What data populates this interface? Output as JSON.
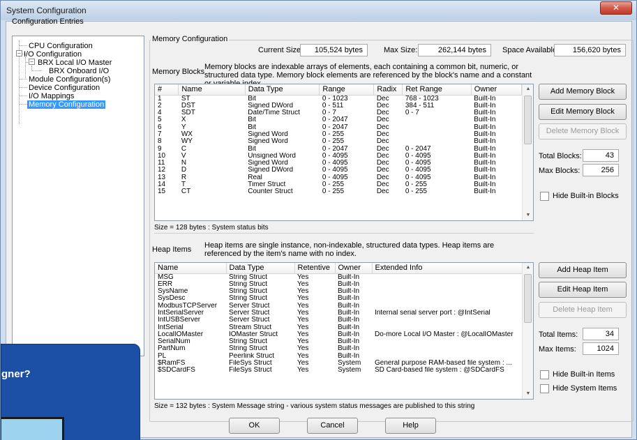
{
  "window": {
    "title": "System Configuration",
    "close_glyph": "✕"
  },
  "tree": {
    "heading": "Configuration Entries",
    "items": [
      {
        "label": "CPU Configuration"
      },
      {
        "label": "I/O Configuration",
        "expander": "−"
      },
      {
        "label": "BRX Local I/O Master",
        "expander": "−"
      },
      {
        "label": "BRX Onboard I/O"
      },
      {
        "label": "Module Configuration(s)"
      },
      {
        "label": "Device Configuration"
      },
      {
        "label": "I/O Mappings"
      },
      {
        "label": "Memory Configuration"
      }
    ]
  },
  "memory": {
    "group_label": "Memory Configuration",
    "current_size_label": "Current Size:",
    "current_size": "105,524 bytes",
    "max_size_label": "Max Size:",
    "max_size": "262,144 bytes",
    "space_available_label": "Space Available:",
    "space_available": "156,620 bytes",
    "blocks_label": "Memory Blocks",
    "blocks_desc": "Memory blocks are indexable arrays of elements, each containing a common bit, numeric, or structured data type. Memory block elements are referenced by the block's name and a constant or variable index.",
    "blocks_columns": [
      "#",
      "Name",
      "Data Type",
      "Range",
      "Radix",
      "Ret Range",
      "Owner"
    ],
    "blocks_rows": [
      [
        "1",
        "ST",
        "Bit",
        "0 - 1023",
        "Dec",
        "768 - 1023",
        "Built-In"
      ],
      [
        "2",
        "DST",
        "Signed DWord",
        "0 - 511",
        "Dec",
        "384 - 511",
        "Built-In"
      ],
      [
        "4",
        "SDT",
        "Date/Time Struct",
        "0 - 7",
        "Dec",
        "0 - 7",
        "Built-In"
      ],
      [
        "5",
        "X",
        "Bit",
        "0 - 2047",
        "Dec",
        "",
        "Built-In"
      ],
      [
        "6",
        "Y",
        "Bit",
        "0 - 2047",
        "Dec",
        "",
        "Built-In"
      ],
      [
        "7",
        "WX",
        "Signed Word",
        "0 - 255",
        "Dec",
        "",
        "Built-In"
      ],
      [
        "8",
        "WY",
        "Signed Word",
        "0 - 255",
        "Dec",
        "",
        "Built-In"
      ],
      [
        "9",
        "C",
        "Bit",
        "0 - 2047",
        "Dec",
        "0 - 2047",
        "Built-In"
      ],
      [
        "10",
        "V",
        "Unsigned Word",
        "0 - 4095",
        "Dec",
        "0 - 4095",
        "Built-In"
      ],
      [
        "11",
        "N",
        "Signed Word",
        "0 - 4095",
        "Dec",
        "0 - 4095",
        "Built-In"
      ],
      [
        "12",
        "D",
        "Signed DWord",
        "0 - 4095",
        "Dec",
        "0 - 4095",
        "Built-In"
      ],
      [
        "13",
        "R",
        "Real",
        "0 - 4095",
        "Dec",
        "0 - 4095",
        "Built-In"
      ],
      [
        "14",
        "T",
        "Timer Struct",
        "0 - 255",
        "Dec",
        "0 - 255",
        "Built-In"
      ],
      [
        "15",
        "CT",
        "Counter Struct",
        "0 - 255",
        "Dec",
        "0 - 255",
        "Built-In"
      ]
    ],
    "blocks_status": "Size = 128 bytes : System status bits",
    "add_block": "Add Memory Block",
    "edit_block": "Edit Memory Block",
    "delete_block": "Delete Memory Block",
    "total_blocks_label": "Total Blocks:",
    "total_blocks": "43",
    "max_blocks_label": "Max Blocks:",
    "max_blocks": "256",
    "hide_builtin_blocks": "Hide Built-in Blocks",
    "heap_label": "Heap Items",
    "heap_desc": "Heap items are single instance, non-indexable, structured data types. Heap items are referenced by the item's name with no index.",
    "heap_columns": [
      "Name",
      "Data Type",
      "Retentive",
      "Owner",
      "Extended Info"
    ],
    "heap_rows": [
      [
        "MSG",
        "String Struct",
        "Yes",
        "Built-In",
        ""
      ],
      [
        "ERR",
        "String Struct",
        "Yes",
        "Built-In",
        ""
      ],
      [
        "SysName",
        "String Struct",
        "Yes",
        "Built-In",
        ""
      ],
      [
        "SysDesc",
        "String Struct",
        "Yes",
        "Built-In",
        ""
      ],
      [
        "ModbusTCPServer",
        "Server Struct",
        "Yes",
        "Built-In",
        ""
      ],
      [
        "IntSerialServer",
        "Server Struct",
        "Yes",
        "Built-In",
        "Internal serial server port : @IntSerial"
      ],
      [
        "IntUSBServer",
        "Server Struct",
        "Yes",
        "Built-In",
        ""
      ],
      [
        "IntSerial",
        "Stream Struct",
        "Yes",
        "Built-In",
        ""
      ],
      [
        "LocalIOMaster",
        "IOMaster Struct",
        "Yes",
        "Built-In",
        "Do-more Local I/O Master : @LocalIOMaster"
      ],
      [
        "SerialNum",
        "String Struct",
        "Yes",
        "Built-In",
        ""
      ],
      [
        "PartNum",
        "String Struct",
        "Yes",
        "Built-In",
        ""
      ],
      [
        "PL",
        "Peerlink Struct",
        "Yes",
        "Built-In",
        ""
      ],
      [
        "$RamFS",
        "FileSys Struct",
        "Yes",
        "System",
        "General purpose RAM-based file system : ..."
      ],
      [
        "$SDCardFS",
        "FileSys Struct",
        "Yes",
        "System",
        "SD Card-based file system : @SDCardFS"
      ]
    ],
    "heap_status": "Size = 132 bytes : System Message string - various system status messages are published to this string",
    "add_heap": "Add Heap Item",
    "edit_heap": "Edit Heap Item",
    "delete_heap": "Delete Heap Item",
    "total_items_label": "Total Items:",
    "total_items": "34",
    "max_items_label": "Max Items:",
    "max_items": "1024",
    "hide_builtin_items": "Hide Built-in Items",
    "hide_system_items": "Hide System Items"
  },
  "footer": {
    "ok": "OK",
    "cancel": "Cancel",
    "help": "Help"
  },
  "promo": {
    "text": "gner?"
  }
}
